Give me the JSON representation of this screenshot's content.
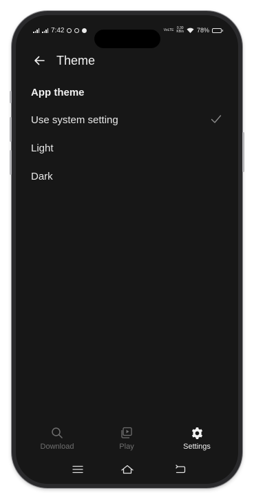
{
  "status_bar": {
    "time": "7:42",
    "net_badge": "VoLTE",
    "speed_value": "0.30",
    "speed_unit": "KB/s",
    "battery": "78%",
    "battery_level": 0.78
  },
  "header": {
    "back_icon": "arrow-left-icon",
    "title": "Theme"
  },
  "section": {
    "title": "App theme"
  },
  "options": [
    {
      "label": "Use system setting",
      "selected": true
    },
    {
      "label": "Light",
      "selected": false
    },
    {
      "label": "Dark",
      "selected": false
    }
  ],
  "bottom_nav": {
    "items": [
      {
        "label": "Download",
        "icon": "search-icon",
        "active": false
      },
      {
        "label": "Play",
        "icon": "play-library-icon",
        "active": false
      },
      {
        "label": "Settings",
        "icon": "gear-icon",
        "active": true
      }
    ]
  },
  "system_nav": {
    "icons": [
      "menu-icon",
      "home-icon",
      "back-icon"
    ]
  },
  "colors": {
    "background": "#171717",
    "text_primary": "#f2f2f2",
    "text_dim": "#6f6f6f"
  }
}
